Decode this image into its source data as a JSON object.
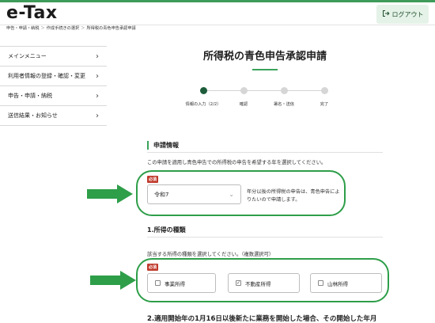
{
  "colors": {
    "brand_green": "#3f9b5a",
    "highlight_green": "#2e9e49",
    "required_red": "#c0392b",
    "step_active": "#1d5c3a"
  },
  "header": {
    "logo": "e-Tax",
    "logout_label": "ログアウト",
    "logout_icon": "logout-icon"
  },
  "breadcrumb": [
    "申告・申請・納税",
    "作成手続きの選択",
    "所得税の青色申告承認申請"
  ],
  "sidebar": {
    "items": [
      {
        "label": "メインメニュー"
      },
      {
        "label": "利用者情報の登録・確認・変更"
      },
      {
        "label": "申告・申請・納税"
      },
      {
        "label": "送信結果・お知らせ"
      }
    ]
  },
  "main": {
    "title": "所得税の青色申告承認申請",
    "stepper": {
      "steps": [
        {
          "label": "情報の入力（2/2）",
          "active": true
        },
        {
          "label": "確認",
          "active": false
        },
        {
          "label": "署名・送信",
          "active": false
        },
        {
          "label": "完了",
          "active": false
        }
      ]
    },
    "section1": {
      "heading": "申請情報",
      "description": "この申請を適用し青色申告での所得税の申告を希望する年を選択してください。",
      "required_label": "必須",
      "select_value": "令和7",
      "note": "年分以後の所得税の申告は、青色申告によりたいので申請します。"
    },
    "section2": {
      "heading": "1.所得の種類",
      "description": "該当する所得の種類を選択してください。（複数選択可）",
      "required_label": "必須",
      "options": [
        {
          "label": "事業所得",
          "checked": false
        },
        {
          "label": "不動産所得",
          "checked": true
        },
        {
          "label": "山林所得",
          "checked": false
        }
      ]
    },
    "section3": {
      "heading": "2.適用開始年の1月16日以後新たに業務を開始した場合、その開始した年月"
    }
  }
}
